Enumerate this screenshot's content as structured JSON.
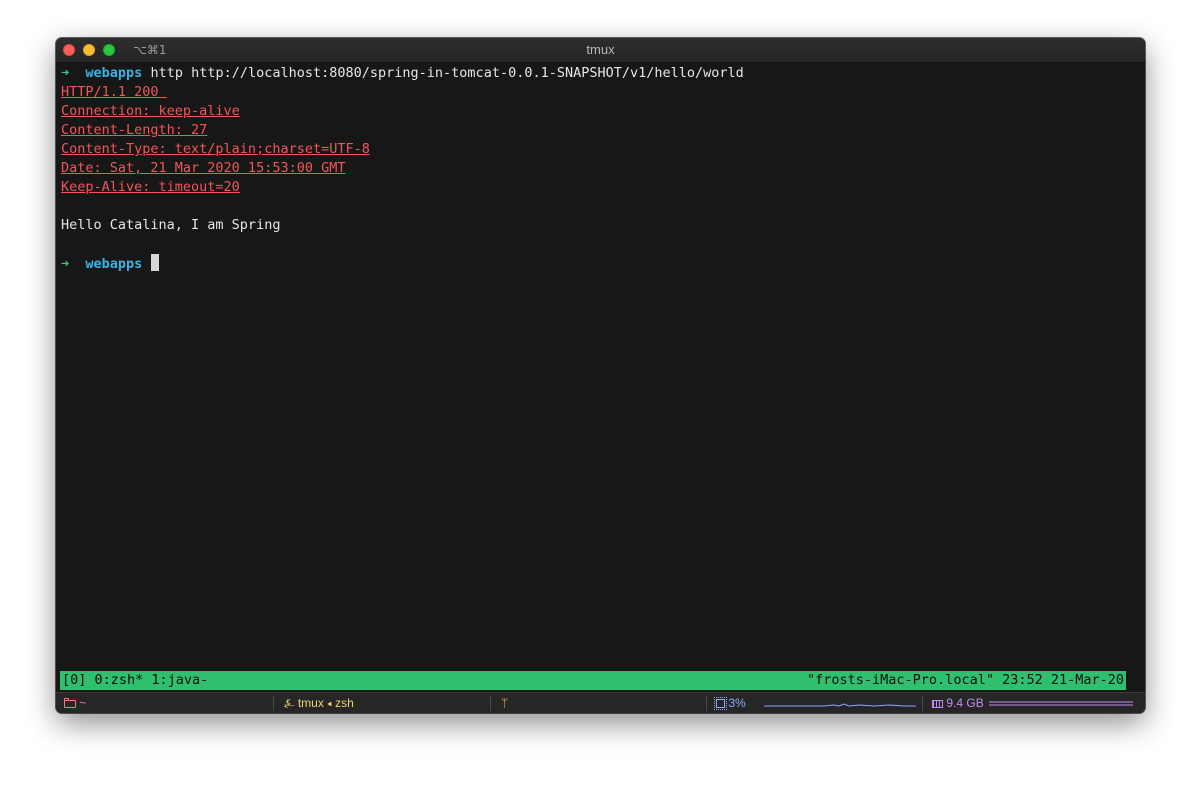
{
  "window": {
    "shortcut": "⌥⌘1",
    "title": "tmux"
  },
  "terminal": {
    "prompt_arrow": "➜",
    "prompt_dir": "webapps",
    "command": "http http://localhost:8080/spring-in-tomcat-0.0.1-SNAPSHOT/v1/hello/world",
    "response_headers": [
      "HTTP/1.1 200 ",
      "Connection: keep-alive",
      "Content-Length: 27",
      "Content-Type: text/plain;charset=UTF-8",
      "Date: Sat, 21 Mar 2020 15:53:00 GMT",
      "Keep-Alive: timeout=20"
    ],
    "response_body": "Hello Catalina, I am Spring"
  },
  "tmux": {
    "left": "[0] 0:zsh* 1:java-",
    "right": "\"frosts-iMac-Pro.local\" 23:52 21-Mar-20"
  },
  "status_bar": {
    "directory": "~",
    "job": "tmux ◂ zsh",
    "cpu": "3%",
    "memory": "9.4 GB",
    "icons": [
      "folder-icon",
      "job-icon",
      "git-branch-icon",
      "cpu-icon",
      "memory-icon"
    ],
    "colors": {
      "directory": "#ef7b7b",
      "job": "#f0d27a",
      "git": "#e8c04a",
      "cpu": "#8ea7ff",
      "memory": "#c08df0",
      "tmux_bar": "#2fbf6f"
    }
  }
}
